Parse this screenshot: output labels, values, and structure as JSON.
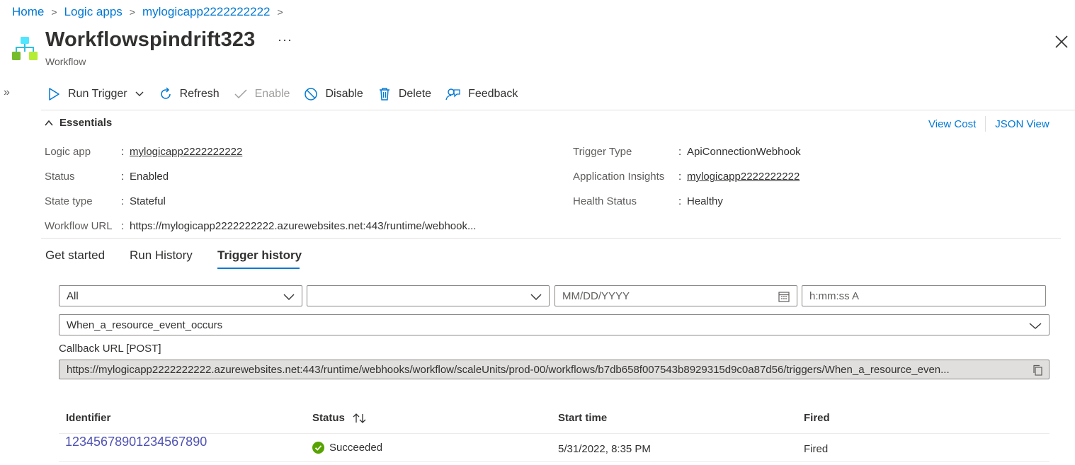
{
  "breadcrumb": {
    "items": [
      "Home",
      "Logic apps",
      "mylogicapp2222222222"
    ],
    "separator": ">"
  },
  "header": {
    "title": "Workflowspindrift323",
    "more": "···",
    "subtitle": "Workflow",
    "icon": "workflow-icon"
  },
  "toolbar": {
    "run_trigger": "Run Trigger",
    "refresh": "Refresh",
    "enable": "Enable",
    "disable": "Disable",
    "delete": "Delete",
    "feedback": "Feedback"
  },
  "essentials": {
    "toggle_label": "Essentials",
    "view_cost": "View Cost",
    "json_view": "JSON View",
    "left": [
      {
        "label": "Logic app",
        "value": "mylogicapp2222222222",
        "is_link": true
      },
      {
        "label": "Status",
        "value": "Enabled",
        "is_link": false
      },
      {
        "label": "State type",
        "value": "Stateful",
        "is_link": false
      },
      {
        "label": "Workflow URL",
        "value": "https://mylogicapp2222222222.azurewebsites.net:443/runtime/webhook...",
        "is_link": false
      }
    ],
    "right": [
      {
        "label": "Trigger Type",
        "value": "ApiConnectionWebhook",
        "is_link": false
      },
      {
        "label": "Application Insights",
        "value": "mylogicapp2222222222",
        "is_link": true
      },
      {
        "label": "Health Status",
        "value": "Healthy",
        "is_link": false
      }
    ]
  },
  "tabs": [
    {
      "label": "Get started",
      "active": false
    },
    {
      "label": "Run History",
      "active": false
    },
    {
      "label": "Trigger history",
      "active": true
    }
  ],
  "filters": {
    "status_value": "All",
    "second_value": "",
    "date_placeholder": "MM/DD/YYYY",
    "time_placeholder": "h:mm:ss A",
    "trigger_value": "When_a_resource_event_occurs"
  },
  "callback": {
    "label": "Callback URL [POST]",
    "url": "https://mylogicapp2222222222.azurewebsites.net:443/runtime/webhooks/workflow/scaleUnits/prod-00/workflows/b7db658f007543b8929315d9c0a87d56/triggers/When_a_resource_even..."
  },
  "table": {
    "columns": [
      "Identifier",
      "Status",
      "Start time",
      "Fired"
    ],
    "rows": [
      {
        "identifier": "12345678901234567890",
        "status": "Succeeded",
        "start_time": "5/31/2022, 8:35 PM",
        "fired": "Fired"
      }
    ]
  },
  "colors": {
    "accent": "#0078d4",
    "success": "#57a300",
    "identifier_link": "#4f52b2"
  }
}
